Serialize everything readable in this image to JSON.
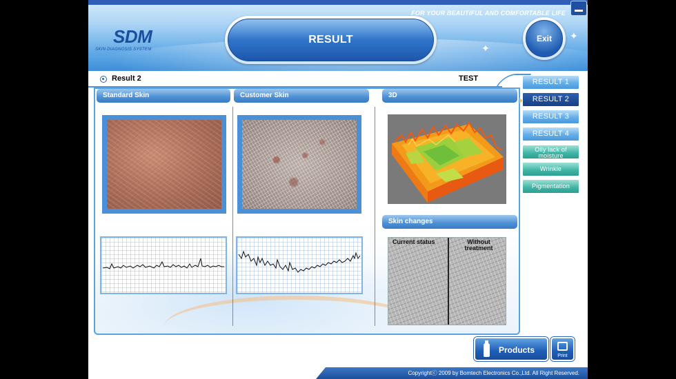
{
  "header": {
    "tagline": "FOR YOUR BEAUTIFUL AND COMFORTABLE LIFE",
    "logo": "SDM",
    "logo_sub": "SKIN DIAGNOSIS SYSTEM",
    "title": "RESULT",
    "exit_label": "Exit"
  },
  "subheader": {
    "result_label": "Result 2",
    "test_label": "TEST"
  },
  "sections": {
    "standard_skin": "Standard Skin",
    "customer_skin": "Customer Skin",
    "three_d": "3D",
    "skin_changes": "Skin changes",
    "current_status": "Current status",
    "without_treatment": "Without treatment"
  },
  "side_tabs": [
    {
      "label": "RESULT 1",
      "active": false
    },
    {
      "label": "RESULT 2",
      "active": true
    },
    {
      "label": "RESULT 3",
      "active": false
    },
    {
      "label": "RESULT 4",
      "active": false
    },
    {
      "label": "Oily lack of moisture",
      "active": false
    },
    {
      "label": "Wrinkle",
      "active": false
    },
    {
      "label": "Pigmentation",
      "active": false
    }
  ],
  "buttons": {
    "products": "Products",
    "print": "Print"
  },
  "footer": {
    "copyright": "Copyrightⓒ 2009 by Bomtech Electronics Co.,Ltd.  All Right Reserved."
  },
  "colors": {
    "accent_blue": "#1f5db5",
    "panel_border": "#5aa3e1",
    "active_tab": "#173f86",
    "green_tab": "#3fb4a4"
  }
}
